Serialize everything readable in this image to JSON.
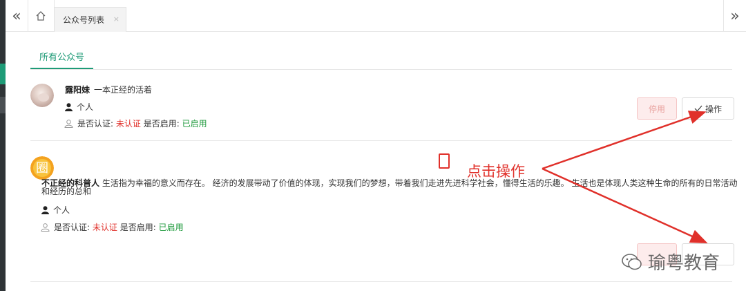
{
  "topbar": {
    "collapse_left_icon": "double-chevron-left",
    "home_icon": "home",
    "tab_label": "公众号列表",
    "tab_close": "×",
    "collapse_right_icon": "double-chevron-right"
  },
  "subtabs": {
    "active": "所有公众号"
  },
  "accounts": [
    {
      "name": "露阳妹",
      "description": "一本正经的活着",
      "type": "个人",
      "verified_label": "是否认证:",
      "verified_value": "未认证",
      "enabled_label": "是否启用:",
      "enabled_value": "已启用",
      "stop_button": "停用",
      "op_button": "操作"
    },
    {
      "name": "不正经的科普人",
      "description": "生活指为幸福的意义而存在。 经济的发展带动了价值的体现，实现我们的梦想，带着我们走进先进科学社会，懂得生活的乐趣。 生活也是体现人类这种生命的所有的日常活动和经历的总和",
      "type": "个人",
      "verified_label": "是否认证:",
      "verified_value": "未认证",
      "enabled_label": "是否启用:",
      "enabled_value": "已启用",
      "avatar_glyph": "圈"
    }
  ],
  "annotation": {
    "text": "点击操作"
  },
  "watermark": {
    "text": "瑜粤教育"
  },
  "colors": {
    "accent": "#1e9b77",
    "red": "#e0302a",
    "green": "#1f9a3c"
  }
}
